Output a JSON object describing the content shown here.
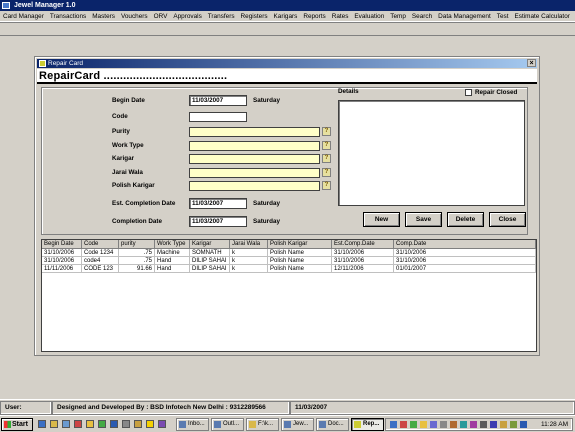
{
  "app": {
    "title": "Jewel Manager 1.0"
  },
  "menu": [
    "Card Manager",
    "Transactions",
    "Masters",
    "Vouchers",
    "ORV",
    "Approvals",
    "Transfers",
    "Registers",
    "Karigars",
    "Reports",
    "Rates",
    "Evaluation",
    "Temp",
    "Search",
    "Data Management",
    "Test",
    "Estimate Calculator"
  ],
  "window": {
    "title": "Repair Card",
    "close_glyph": "×",
    "heading": "RepairCard ......................................"
  },
  "form": {
    "begin_date_label": "Begin Date",
    "begin_date_value": "11/03/2007",
    "begin_day": "Saturday",
    "code_label": "Code",
    "code_value": "",
    "purity_label": "Purity",
    "work_type_label": "Work Type",
    "karigar_label": "Karigar",
    "jarai_wala_label": "Jarai Wala",
    "polish_karigar_label": "Polish Karigar",
    "est_completion_label": "Est. Completion Date",
    "est_completion_value": "11/03/2007",
    "est_completion_day": "Saturday",
    "completion_label": "Completion Date",
    "completion_value": "11/03/2007",
    "completion_day": "Saturday",
    "details_label": "Details",
    "repair_closed_label": "Repair Closed",
    "lookup_glyph": "?"
  },
  "buttons": {
    "new": "New",
    "save": "Save",
    "delete": "Delete",
    "close": "Close"
  },
  "grid": {
    "columns": [
      "Begin Date",
      "Code",
      "purity",
      "Work Type",
      "Karigar",
      "Jarai Wala",
      "Polish Karigar",
      "Est.Comp.Date",
      "Comp.Date"
    ],
    "rows": [
      [
        "31/10/2006",
        "Code 1234",
        ".75",
        "Machine",
        "SOMNATH",
        "k",
        "Polish Name",
        "31/10/2006",
        "31/10/2006"
      ],
      [
        "31/10/2006",
        "code4",
        ".75",
        "Hand",
        "DILIP SAHAI",
        "k",
        "Polish Name",
        "31/10/2006",
        "31/10/2006"
      ],
      [
        "11/11/2006",
        "CODE 123",
        "91.66",
        "Hand",
        "DILIP SAHAI",
        "k",
        "Polish Name",
        "12/11/2006",
        "01/01/2007"
      ]
    ]
  },
  "status": {
    "user": "User:",
    "developer": "Designed and Developed By : BSD Infotech New Delhi : 9312289566",
    "date": "11/03/2007"
  },
  "taskbar": {
    "start": "Start",
    "tasks": [
      "Inbo...",
      "Outl...",
      "F:\\k...",
      "Jew...",
      "Doc...",
      "Rep..."
    ],
    "clock": "11:28 AM"
  }
}
